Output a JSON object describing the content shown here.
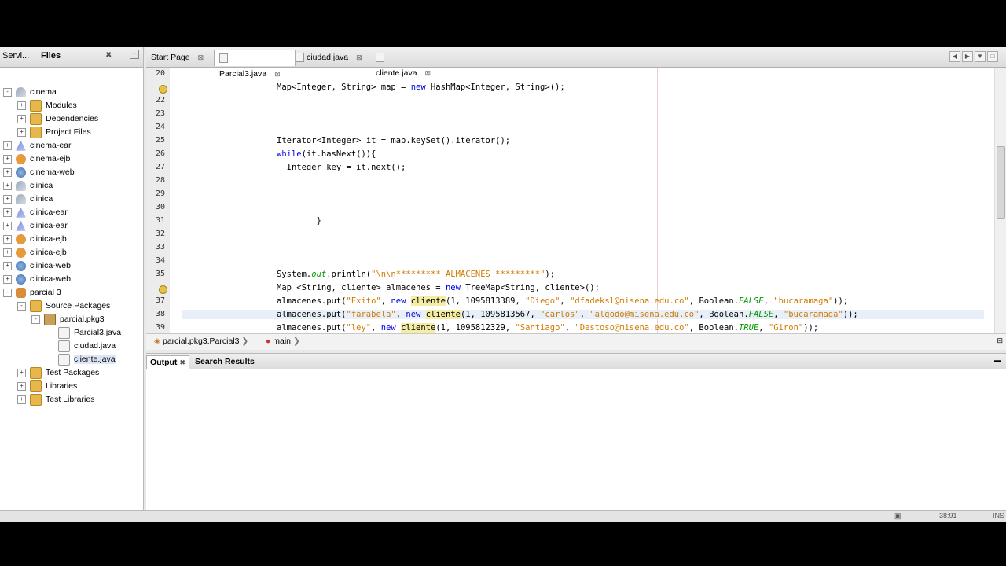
{
  "left_panel": {
    "tabs": [
      "Servi...",
      "Files"
    ],
    "tree": [
      {
        "label": "cinema",
        "icon": "project-icon",
        "level": 0,
        "expander": "-"
      },
      {
        "label": "Modules",
        "icon": "folder-icon",
        "level": 1,
        "expander": "+"
      },
      {
        "label": "Dependencies",
        "icon": "folder-icon",
        "level": 1,
        "expander": "+"
      },
      {
        "label": "Project Files",
        "icon": "folder-icon",
        "level": 1,
        "expander": "+"
      },
      {
        "label": "cinema-ear",
        "icon": "ear-icon",
        "level": 0,
        "expander": "+"
      },
      {
        "label": "cinema-ejb",
        "icon": "ejb-icon",
        "level": 0,
        "expander": "+"
      },
      {
        "label": "cinema-web",
        "icon": "web-icon",
        "level": 0,
        "expander": "+"
      },
      {
        "label": "clinica",
        "icon": "project-icon",
        "level": 0,
        "expander": "+"
      },
      {
        "label": "clinica",
        "icon": "project-icon",
        "level": 0,
        "expander": "+"
      },
      {
        "label": "clinica-ear",
        "icon": "ear-icon",
        "level": 0,
        "expander": "+"
      },
      {
        "label": "clinica-ear",
        "icon": "ear-icon",
        "level": 0,
        "expander": "+"
      },
      {
        "label": "clinica-ejb",
        "icon": "ejb-icon",
        "level": 0,
        "expander": "+"
      },
      {
        "label": "clinica-ejb",
        "icon": "ejb-icon",
        "level": 0,
        "expander": "+"
      },
      {
        "label": "clinica-web",
        "icon": "web-icon",
        "level": 0,
        "expander": "+"
      },
      {
        "label": "clinica-web",
        "icon": "web-icon",
        "level": 0,
        "expander": "+"
      },
      {
        "label": "parcial 3",
        "icon": "parcial-icon",
        "level": 0,
        "expander": "-"
      },
      {
        "label": "Source Packages",
        "icon": "folder-icon",
        "level": 1,
        "expander": "-"
      },
      {
        "label": "parcial.pkg3",
        "icon": "package-icon",
        "level": 2,
        "expander": "-"
      },
      {
        "label": "Parcial3.java",
        "icon": "java-file-icon",
        "level": 3,
        "expander": ""
      },
      {
        "label": "ciudad.java",
        "icon": "java-file-icon",
        "level": 3,
        "expander": ""
      },
      {
        "label": "cliente.java",
        "icon": "java-file-icon",
        "level": 3,
        "expander": "",
        "selected": true
      },
      {
        "label": "Test Packages",
        "icon": "folder-icon",
        "level": 1,
        "expander": "+"
      },
      {
        "label": "Libraries",
        "icon": "folder-icon",
        "level": 1,
        "expander": "+"
      },
      {
        "label": "Test Libraries",
        "icon": "folder-icon",
        "level": 1,
        "expander": "+"
      }
    ]
  },
  "editor": {
    "tabs": [
      {
        "label": "Start Page",
        "active": false
      },
      {
        "label": "Parcial3.java",
        "active": true
      },
      {
        "label": "ciudad.java",
        "active": false
      },
      {
        "label": "cliente.java",
        "active": false
      }
    ],
    "line_numbers": [
      "20",
      "",
      "22",
      "23",
      "24",
      "25",
      "26",
      "27",
      "28",
      "29",
      "30",
      "31",
      "32",
      "33",
      "34",
      "35",
      "",
      "37",
      "38",
      "39"
    ],
    "bulb_lines": [
      1,
      16
    ],
    "code": [
      [],
      [
        [
          "",
          "Map<Integer, String> map = "
        ],
        [
          "kw",
          "new"
        ],
        [
          "",
          " HashMap<Integer, String>();"
        ]
      ],
      [],
      [],
      [],
      [
        [
          "",
          "Iterator<Integer> it = map.keySet().iterator();"
        ]
      ],
      [
        [
          "kw",
          "while"
        ],
        [
          "",
          "(it.hasNext()){"
        ]
      ],
      [
        [
          "",
          "  Integer key = it.next();"
        ]
      ],
      [],
      [],
      [],
      [
        [
          "",
          "        }"
        ]
      ],
      [],
      [],
      [],
      [
        [
          "",
          "System."
        ],
        [
          "fld",
          "out"
        ],
        [
          "",
          ".println("
        ],
        [
          "str",
          "\"\\n\\n********* ALMACENES *********\""
        ],
        [
          "",
          ");"
        ]
      ],
      [
        [
          "",
          "Map <String, cliente> almacenes = "
        ],
        [
          "kw",
          "new"
        ],
        [
          "",
          " TreeMap<String, cliente>();"
        ]
      ],
      [
        [
          "",
          "almacenes.put("
        ],
        [
          "str",
          "\"Exito\""
        ],
        [
          "",
          ", "
        ],
        [
          "kw",
          "new"
        ],
        [
          "",
          " "
        ],
        [
          "hl",
          "cliente"
        ],
        [
          "",
          "(1, 1095813389, "
        ],
        [
          "str",
          "\"Diego\""
        ],
        [
          "",
          ", "
        ],
        [
          "str",
          "\"dfadeksl@misena.edu.co\""
        ],
        [
          "",
          ", Boolean."
        ],
        [
          "fld",
          "FALSE"
        ],
        [
          "",
          ", "
        ],
        [
          "str",
          "\"bucaramaga\""
        ],
        [
          "",
          "));"
        ]
      ],
      [
        [
          "",
          "almacenes.put("
        ],
        [
          "str",
          "\"farabela\""
        ],
        [
          "",
          ", "
        ],
        [
          "kw",
          "new"
        ],
        [
          "",
          " "
        ],
        [
          "hl",
          "cliente"
        ],
        [
          "",
          "(1, 1095813567, "
        ],
        [
          "str",
          "\"carlos\""
        ],
        [
          "",
          ", "
        ],
        [
          "str",
          "\"algodo@misena.edu.co\""
        ],
        [
          "",
          ", Boolean."
        ],
        [
          "fld",
          "FALSE"
        ],
        [
          "",
          ", "
        ],
        [
          "str",
          "\"bucaramaga\""
        ],
        [
          "",
          "));"
        ]
      ],
      [
        [
          "",
          "almacenes.put("
        ],
        [
          "str",
          "\"ley\""
        ],
        [
          "",
          ", "
        ],
        [
          "kw",
          "new"
        ],
        [
          "",
          " "
        ],
        [
          "hl",
          "cliente"
        ],
        [
          "",
          "(1, 1095812329, "
        ],
        [
          "str",
          "\"Santiago\""
        ],
        [
          "",
          ", "
        ],
        [
          "str",
          "\"Destoso@misena.edu.co\""
        ],
        [
          "",
          ", Boolean."
        ],
        [
          "fld",
          "TRUE"
        ],
        [
          "",
          ", "
        ],
        [
          "str",
          "\"Giron\""
        ],
        [
          "",
          "));"
        ]
      ]
    ],
    "current_line_index": 18,
    "breadcrumb": {
      "class": "parcial.pkg3.Parcial3",
      "method": "main"
    }
  },
  "output": {
    "tabs": [
      "Output",
      "Search Results"
    ]
  },
  "status": {
    "position": "38:91",
    "mode": "INS"
  }
}
